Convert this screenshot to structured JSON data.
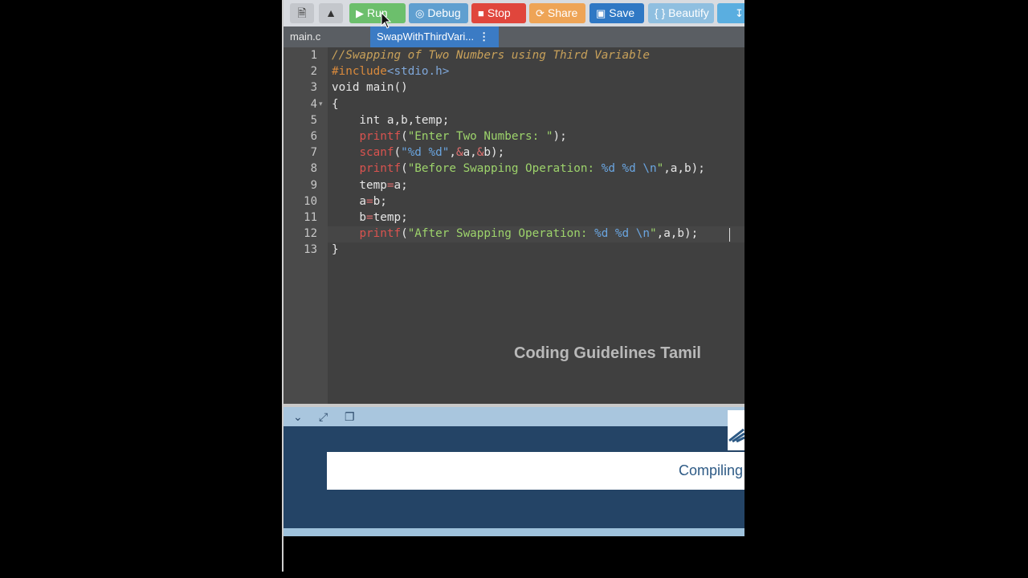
{
  "toolbar": {
    "buttons": [
      {
        "label": "Run",
        "color": "#6cbf6c"
      },
      {
        "label": "Debug",
        "color": "#5f9fd0"
      },
      {
        "label": "Stop",
        "color": "#e0463c"
      },
      {
        "label": "Share",
        "color": "#eea456"
      },
      {
        "label": "Save",
        "color": "#2f78c4"
      },
      {
        "label": "{ } Beautify",
        "color": "#8fbfe0"
      }
    ]
  },
  "tabs": [
    {
      "label": "main.c",
      "active": false
    },
    {
      "label": "SwapWithThirdVari...",
      "active": true
    }
  ],
  "editor": {
    "line_numbers": [
      "1",
      "2",
      "3",
      "4",
      "5",
      "6",
      "7",
      "8",
      "9",
      "10",
      "11",
      "12",
      "13"
    ],
    "lines": [
      [
        {
          "t": "//Swapping of Two Numbers using Third Variable",
          "c": "c-comment"
        }
      ],
      [
        {
          "t": "#include",
          "c": "c-pp"
        },
        {
          "t": "<stdio.h>",
          "c": "c-inc"
        }
      ],
      [
        {
          "t": "void main()",
          "c": "c-plain"
        }
      ],
      [
        {
          "t": "{",
          "c": "c-plain"
        }
      ],
      [
        {
          "t": "    int a,b,temp;",
          "c": "c-plain"
        }
      ],
      [
        {
          "t": "    ",
          "c": "c-plain"
        },
        {
          "t": "printf",
          "c": "c-fn"
        },
        {
          "t": "(",
          "c": "c-plain"
        },
        {
          "t": "\"Enter Two Numbers: \"",
          "c": "c-str"
        },
        {
          "t": ");",
          "c": "c-plain"
        }
      ],
      [
        {
          "t": "    ",
          "c": "c-plain"
        },
        {
          "t": "scanf",
          "c": "c-fn"
        },
        {
          "t": "(",
          "c": "c-plain"
        },
        {
          "t": "\"%d %d\"",
          "c": "c-fmt"
        },
        {
          "t": ",",
          "c": "c-plain"
        },
        {
          "t": "&",
          "c": "c-op"
        },
        {
          "t": "a,",
          "c": "c-plain"
        },
        {
          "t": "&",
          "c": "c-op"
        },
        {
          "t": "b);",
          "c": "c-plain"
        }
      ],
      [
        {
          "t": "    ",
          "c": "c-plain"
        },
        {
          "t": "printf",
          "c": "c-fn"
        },
        {
          "t": "(",
          "c": "c-plain"
        },
        {
          "t": "\"Before Swapping Operation: ",
          "c": "c-str"
        },
        {
          "t": "%d %d \\n",
          "c": "c-fmt"
        },
        {
          "t": "\"",
          "c": "c-str"
        },
        {
          "t": ",a,b);",
          "c": "c-plain"
        }
      ],
      [
        {
          "t": "    temp",
          "c": "c-plain"
        },
        {
          "t": "=",
          "c": "c-op"
        },
        {
          "t": "a;",
          "c": "c-plain"
        }
      ],
      [
        {
          "t": "    a",
          "c": "c-plain"
        },
        {
          "t": "=",
          "c": "c-op"
        },
        {
          "t": "b;",
          "c": "c-plain"
        }
      ],
      [
        {
          "t": "    b",
          "c": "c-plain"
        },
        {
          "t": "=",
          "c": "c-op"
        },
        {
          "t": "temp;",
          "c": "c-plain"
        }
      ],
      [
        {
          "t": "    ",
          "c": "c-plain"
        },
        {
          "t": "printf",
          "c": "c-fn"
        },
        {
          "t": "(",
          "c": "c-plain"
        },
        {
          "t": "\"After Swapping Operation: ",
          "c": "c-str"
        },
        {
          "t": "%d %d \\n",
          "c": "c-fmt"
        },
        {
          "t": "\"",
          "c": "c-str"
        },
        {
          "t": ",a,b);",
          "c": "c-plain"
        }
      ],
      [
        {
          "t": "}",
          "c": "c-plain"
        }
      ]
    ],
    "watermark": "Coding Guidelines Tamil"
  },
  "output": {
    "status": "Compiling"
  }
}
